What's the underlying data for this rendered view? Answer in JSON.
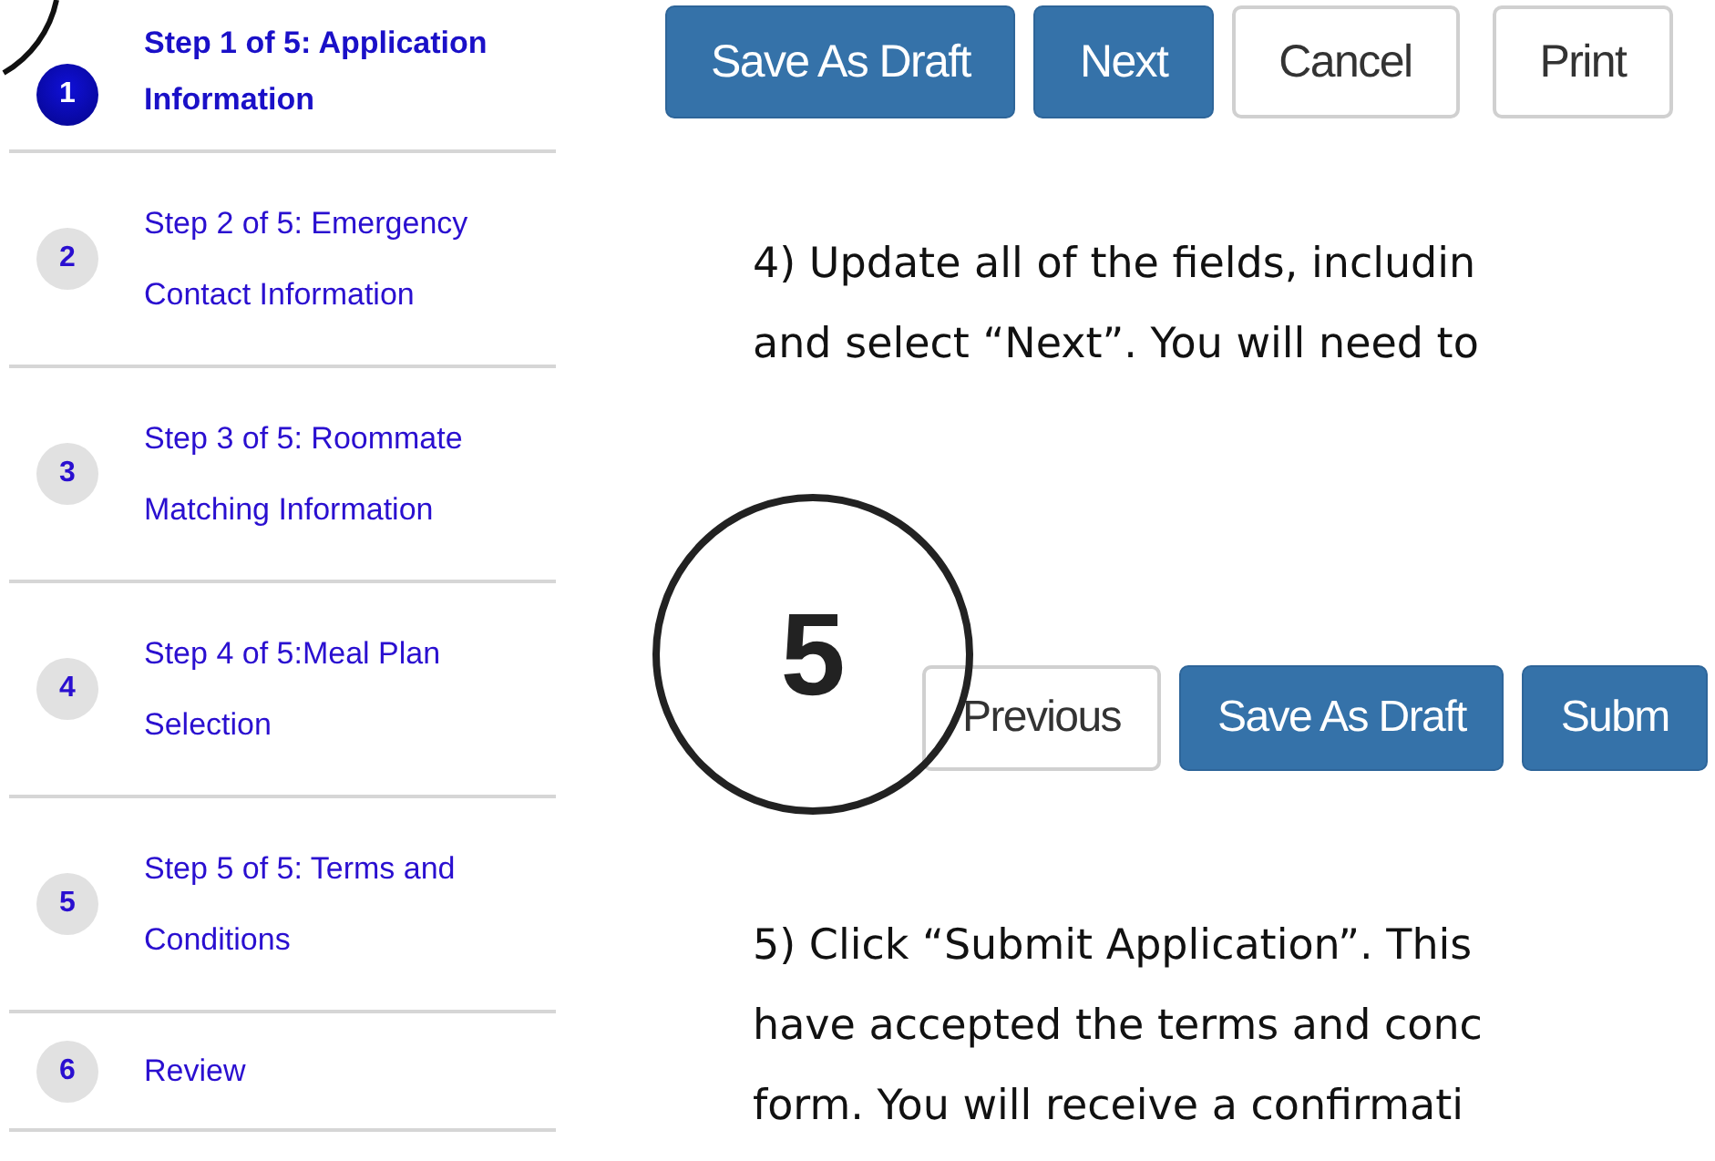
{
  "steps": [
    {
      "number": "1",
      "label": "Step 1 of 5: Application Information",
      "selected": true
    },
    {
      "number": "2",
      "label": "Step 2 of 5: Emergency Contact Information",
      "selected": false
    },
    {
      "number": "3",
      "label": "Step 3 of 5: Roommate Matching Information",
      "selected": false
    },
    {
      "number": "4",
      "label": "Step 4 of 5:Meal Plan Selection",
      "selected": false
    },
    {
      "number": "5",
      "label": "Step 5 of 5: Terms and Conditions",
      "selected": false
    },
    {
      "number": "6",
      "label": "Review",
      "selected": false
    }
  ],
  "top_buttons": [
    {
      "label": "Save As Draft",
      "kind": "primary"
    },
    {
      "label": "Next",
      "kind": "primary"
    },
    {
      "label": "Cancel",
      "kind": "secondary"
    },
    {
      "label": "Print",
      "kind": "secondary"
    }
  ],
  "instruction_4": [
    "4) Update all of the fields, includin",
    "and select “Next”. You will need to"
  ],
  "step_marker": "5",
  "bottom_buttons": [
    {
      "label": "Previous",
      "kind": "secondary"
    },
    {
      "label": "Save As Draft",
      "kind": "primary"
    },
    {
      "label": "Subm",
      "kind": "primary"
    }
  ],
  "instruction_5": [
    "5) Click “Submit Application”. This",
    "have accepted the terms and conc",
    "form. You will receive a confirmati"
  ]
}
